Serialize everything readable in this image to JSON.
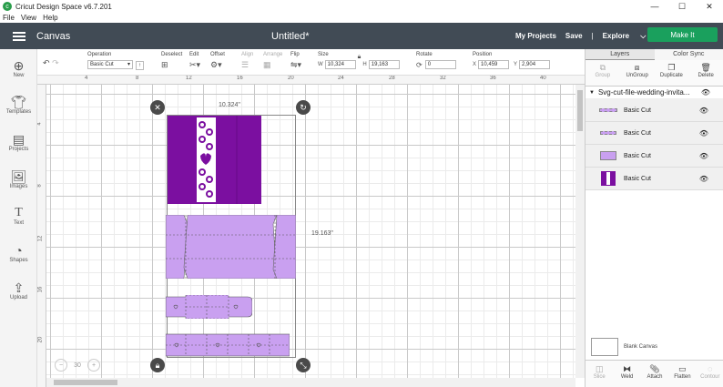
{
  "window": {
    "title": "Cricut Design Space  v6.7.201",
    "minimize": "—",
    "maximize": "☐",
    "close": "✕"
  },
  "menu": [
    "File",
    "View",
    "Help"
  ],
  "header": {
    "section": "Canvas",
    "document_title": "Untitled*",
    "my_projects": "My Projects",
    "save": "Save",
    "separator": "|",
    "explore": "Explore",
    "make_it": "Make It"
  },
  "toolbar": {
    "operation_label": "Operation",
    "operation_value": "Basic Cut",
    "deselect_label": "Deselect",
    "edit_label": "Edit",
    "offset_label": "Offset",
    "align_label": "Align",
    "arrange_label": "Arrange",
    "flip_label": "Flip",
    "size_label": "Size",
    "w_label": "W",
    "w_value": "10,324",
    "h_label": "H",
    "h_value": "19,163",
    "rotate_label": "Rotate",
    "rotate_value": "0",
    "position_label": "Position",
    "x_label": "X",
    "x_value": "10,459",
    "y_label": "Y",
    "y_value": "2,904"
  },
  "sidebar": {
    "items": [
      {
        "label": "New",
        "icon": "plus-icon"
      },
      {
        "label": "Templates",
        "icon": "shirt-icon"
      },
      {
        "label": "Projects",
        "icon": "projects-icon"
      },
      {
        "label": "Images",
        "icon": "image-icon"
      },
      {
        "label": "Text",
        "icon": "text-icon"
      },
      {
        "label": "Shapes",
        "icon": "shapes-icon"
      },
      {
        "label": "Upload",
        "icon": "upload-icon"
      }
    ]
  },
  "rulers": {
    "top": [
      "4",
      "8",
      "12",
      "16",
      "20",
      "24",
      "28",
      "32",
      "36",
      "40"
    ],
    "left": [
      "4",
      "8",
      "12",
      "16",
      "20"
    ]
  },
  "canvas": {
    "width_label": "10.324\"",
    "height_label": "19.163\"",
    "zoom_value": "30"
  },
  "layers_panel": {
    "tabs": [
      "Layers",
      "Color Sync"
    ],
    "actions": [
      "Group",
      "UnGroup",
      "Duplicate",
      "Delete"
    ],
    "group_name": "Svg-cut-file-wedding-invita...",
    "layers": [
      {
        "name": "Basic Cut"
      },
      {
        "name": "Basic Cut"
      },
      {
        "name": "Basic Cut"
      },
      {
        "name": "Basic Cut"
      }
    ],
    "blank_canvas": "Blank Canvas",
    "bottom_actions": [
      "Slice",
      "Weld",
      "Attach",
      "Flatten",
      "Contour"
    ]
  },
  "colors": {
    "header_bg": "#414b55",
    "make_it": "#1aa05d",
    "dark_purple": "#7b0fa0",
    "light_purple": "#c9a0f0"
  }
}
